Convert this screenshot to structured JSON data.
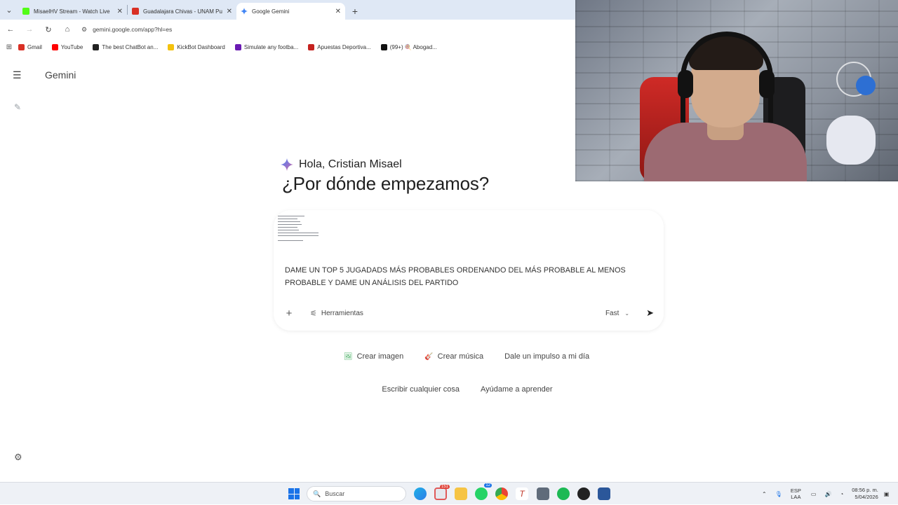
{
  "browser": {
    "tabs": [
      {
        "title": "MisaelHV Stream - Watch Live",
        "color": "#53fc18",
        "active": false
      },
      {
        "title": "Guadalajara Chivas - UNAM Pu",
        "color": "#d93025",
        "active": false
      },
      {
        "title": "Google Gemini",
        "color": "#4285f4",
        "active": true
      }
    ],
    "url": "gemini.google.com/app?hl=es",
    "bookmarks": [
      {
        "label": "Gmail",
        "color": "#d93025"
      },
      {
        "label": "YouTube",
        "color": "#ff0000"
      },
      {
        "label": "The best ChatBot an...",
        "color": "#222222"
      },
      {
        "label": "KickBot Dashboard",
        "color": "#f4c20d"
      },
      {
        "label": "Simulate any footba...",
        "color": "#6a1bb3"
      },
      {
        "label": "Apuestas Deportiva...",
        "color": "#c5221f"
      },
      {
        "label": "(99+) 🍭 Abogad...",
        "color": "#111111"
      }
    ]
  },
  "app": {
    "title": "Gemini",
    "greeting": "Hola, Cristian Misael",
    "headline": "¿Por dónde empezamos?",
    "prompt_text": "DAME UN TOP 5 JUGADADS MÁS PROBABLES ORDENANDO DEL MÁS PROBABLE AL MENOS PROBABLE Y DAME UN ANÁLISIS DEL PARTIDO",
    "tools_label": "Herramientas",
    "mode_label": "Fast",
    "chips_row1": [
      {
        "label": "Crear imagen",
        "icon": "image-icon",
        "glyph": "🖼"
      },
      {
        "label": "Crear música",
        "icon": "guitar-icon",
        "glyph": "🎸"
      },
      {
        "label": "Dale un impulso a mi día",
        "icon": "",
        "glyph": ""
      }
    ],
    "chips_row2": [
      {
        "label": "Escribir cualquier cosa"
      },
      {
        "label": "Ayúdame a aprender"
      }
    ],
    "accent": "#4285f4"
  },
  "taskbar": {
    "search_placeholder": "Buscar",
    "lang_top": "ESP",
    "lang_bottom": "LAA",
    "time": "08:56 p. m.",
    "date": "5/04/2026",
    "badge_count_1": "151",
    "badge_count_2": "12"
  }
}
